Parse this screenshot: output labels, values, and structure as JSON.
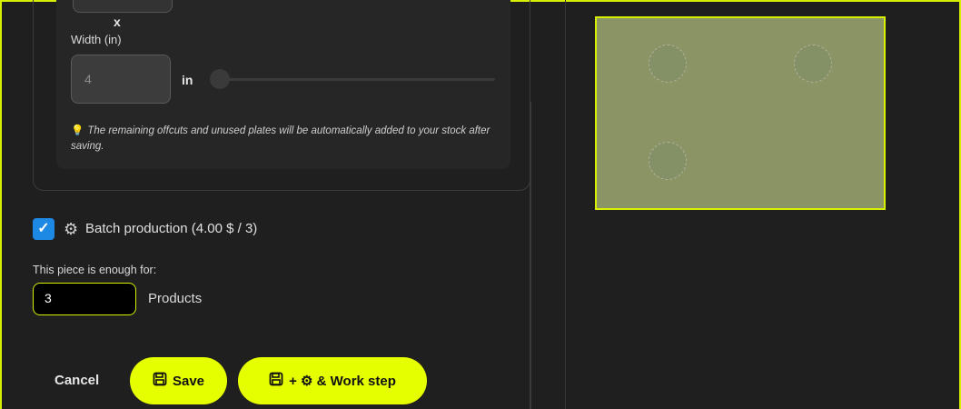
{
  "form": {
    "dimension_separator": "x",
    "width_label": "Width (in)",
    "width_value": "4",
    "width_unit": "in",
    "hint_text": "The remaining offcuts and unused plates will be automatically added to your stock after saving.",
    "batch": {
      "checked": true,
      "label": "Batch production (4.00 $ / 3)"
    },
    "enough_label": "This piece is enough for:",
    "quantity_value": "3",
    "quantity_unit": "Products"
  },
  "actions": {
    "cancel_label": "Cancel",
    "save_label": "Save",
    "save_workstep_label": "+ ⚙ & Work step"
  },
  "icons": {
    "save": "floppy-disk-icon",
    "gear": "gear-icon",
    "hint": "lightbulb-icon",
    "check": "checkmark-icon"
  },
  "colors": {
    "accent": "#e6ff00",
    "checkbox": "#1e88e5",
    "plate": "#8a9465"
  }
}
